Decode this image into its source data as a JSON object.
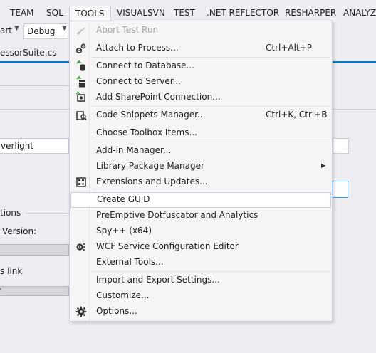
{
  "menubar": {
    "items": [
      "TEAM",
      "SQL",
      "TOOLS",
      "VISUALSVN",
      "TEST",
      ".NET REFLECTOR",
      "RESHARPER",
      "ANALYZ"
    ]
  },
  "toolbar": {
    "start_fragment": "art",
    "config_value": "Debug"
  },
  "document": {
    "tab_title": "essorSuite.cs",
    "field_value": "verlight",
    "section_label": "tions",
    "version_label": "Version:",
    "link_label": "s link"
  },
  "tools_menu": {
    "items": [
      {
        "label": "Abort Test Run",
        "shortcut": "",
        "icon": "abort-test-run-icon",
        "disabled": true
      },
      {
        "label": "Attach to Process...",
        "shortcut": "Ctrl+Alt+P",
        "icon": "attach-process-icon"
      },
      {
        "label": "Connect to Database...",
        "shortcut": "",
        "icon": "connect-database-icon"
      },
      {
        "label": "Connect to Server...",
        "shortcut": "",
        "icon": "connect-server-icon"
      },
      {
        "label": "Add SharePoint Connection...",
        "shortcut": "",
        "icon": "sharepoint-connection-icon"
      },
      {
        "label": "Code Snippets Manager...",
        "shortcut": "Ctrl+K, Ctrl+B",
        "icon": "code-snippets-icon"
      },
      {
        "label": "Choose Toolbox Items...",
        "shortcut": ""
      },
      {
        "label": "Add-in Manager...",
        "shortcut": ""
      },
      {
        "label": "Library Package Manager",
        "shortcut": "",
        "submenu": true
      },
      {
        "label": "Extensions and Updates...",
        "shortcut": "",
        "icon": "extensions-icon"
      },
      {
        "label": "Create GUID",
        "shortcut": "",
        "highlighted": true
      },
      {
        "label": "PreEmptive Dotfuscator and Analytics",
        "shortcut": ""
      },
      {
        "label": "Spy++ (x64)",
        "shortcut": ""
      },
      {
        "label": "WCF Service Configuration Editor",
        "shortcut": "",
        "icon": "wcf-config-icon"
      },
      {
        "label": "External Tools...",
        "shortcut": ""
      },
      {
        "label": "Import and Export Settings...",
        "shortcut": ""
      },
      {
        "label": "Customize...",
        "shortcut": ""
      },
      {
        "label": "Options...",
        "shortcut": "",
        "icon": "gear-icon"
      }
    ]
  },
  "colors": {
    "accent": "#007acc",
    "menu_bg": "#f5f5f5",
    "chrome_bg": "#eeeef2",
    "disabled_text": "#a2a4a5"
  }
}
